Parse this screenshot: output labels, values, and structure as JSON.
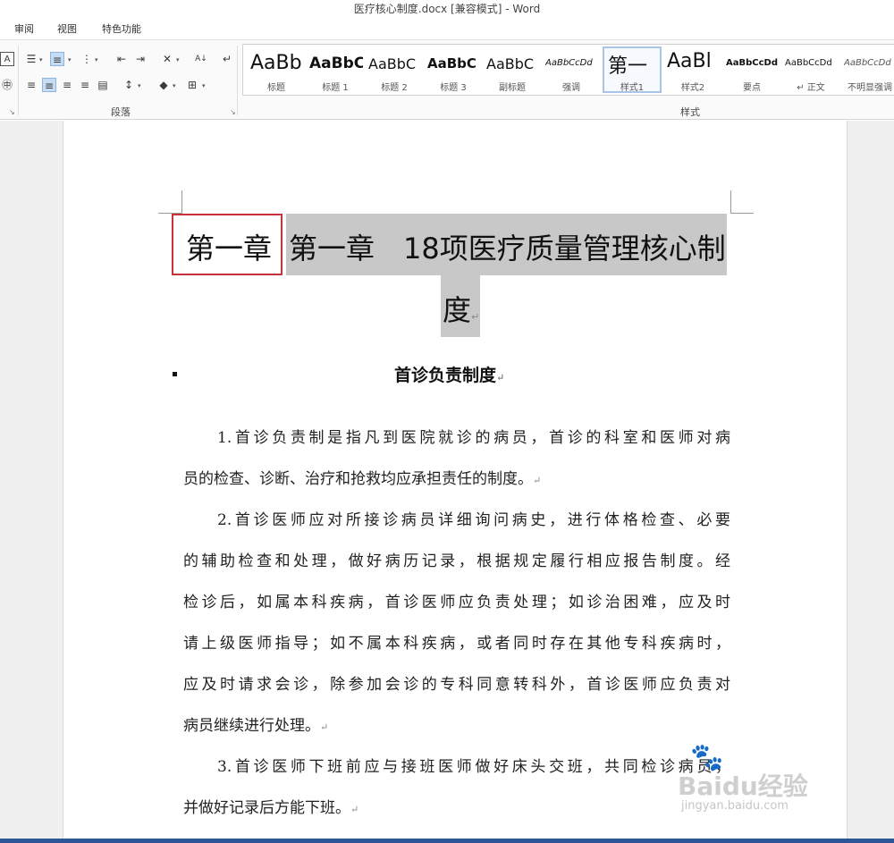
{
  "window": {
    "title": "医疗核心制度.docx [兼容模式] - Word"
  },
  "menu": {
    "tabs": [
      "审阅",
      "视图",
      "特色功能"
    ]
  },
  "ribbon": {
    "groups": {
      "paragraph": "段落",
      "styles": "样式"
    },
    "styles": [
      {
        "sample": "AaBb",
        "name": "标题"
      },
      {
        "sample": "AaBbC",
        "name": "标题 1"
      },
      {
        "sample": "AaBbC",
        "name": "标题 2"
      },
      {
        "sample": "AaBbC",
        "name": "标题 3"
      },
      {
        "sample": "AaBbC",
        "name": "副标题"
      },
      {
        "sample": "AaBbCcDd",
        "name": "强调"
      },
      {
        "sample": "第一",
        "name": "样式1"
      },
      {
        "sample": "AaBl",
        "name": "样式2"
      },
      {
        "sample": "AaBbCcDd",
        "name": "要点"
      },
      {
        "sample": "AaBbCcDd",
        "name": "↵ 正文"
      },
      {
        "sample": "AaBbCcDd",
        "name": "不明显强调"
      }
    ],
    "active_style": "样式1",
    "icons": [
      "text-border-icon",
      "bullets-icon",
      "numbering-icon",
      "multilevel-list-icon",
      "decrease-indent-icon",
      "increase-indent-icon",
      "chinese-layout-icon",
      "sort-icon",
      "show-marks-icon",
      "phonetic-icon",
      "align-left-icon",
      "align-center-icon",
      "align-right-icon",
      "justify-icon",
      "distributed-icon",
      "line-spacing-icon",
      "shading-icon",
      "borders-icon"
    ]
  },
  "document": {
    "chapter_label": "第一章",
    "title_line1": "第一章　18项医疗质量管理核心制",
    "title_line2": "度",
    "section_heading": "首诊负责制度",
    "paragraph_mark": "↵",
    "body_lines": [
      "1.首诊负责制是指凡到医院就诊的病员，首诊的科室和医师对病",
      "员的检查、诊断、治疗和抢救均应承担责任的制度。",
      "2.首诊医师应对所接诊病员详细询问病史，进行体格检查、必要",
      "的辅助检查和处理，做好病历记录，根据规定履行相应报告制度。经",
      "检诊后，如属本科疾病，首诊医师应负责处理；如诊治困难，应及时",
      "请上级医师指导；如不属本科疾病，或者同时存在其他专科疾病时，",
      "应及时请求会诊，除参加会诊的专科同意转科外，首诊医师应负责对",
      "病员继续进行处理。",
      "3.首诊医师下班前应与接班医师做好床头交班，共同检诊病员，",
      "并做好记录后方能下班。"
    ]
  },
  "watermark": {
    "brand": "Baidu经验",
    "url": "jingyan.baidu.com"
  }
}
